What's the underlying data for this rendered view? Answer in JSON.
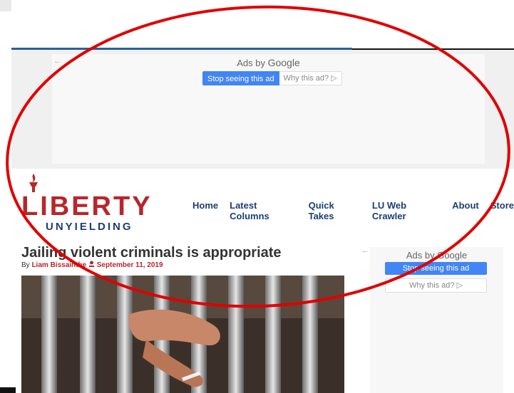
{
  "top_ad": {
    "back_arrow": "←",
    "title_prefix": "Ads by ",
    "title_brand": "Google",
    "stop_label": "Stop seeing this ad",
    "why_label": "Why this ad? ▷"
  },
  "header": {
    "logo_top": "LIBERTY",
    "logo_bottom": "UNYIELDING",
    "nav": [
      "Home",
      "Latest Columns",
      "Quick Takes",
      "LU Web Crawler",
      "About",
      "Store"
    ]
  },
  "article": {
    "title": "Jailing violent criminals is appropriate",
    "by_prefix": "By ",
    "author": "Liam Bissainthe",
    "date": "September 11, 2019"
  },
  "side_ad": {
    "back_arrow": "←",
    "title_prefix": "Ads by ",
    "title_brand": "Google",
    "stop_label": "Stop seeing this ad",
    "why_label": "Why this ad? ▷"
  },
  "colors": {
    "brand_red": "#b8262b",
    "brand_blue": "#1c3f73",
    "google_blue": "#4285f4",
    "annotation_red": "#e00000"
  },
  "icons": [
    "torch-icon",
    "author-icon",
    "back-arrow-icon"
  ]
}
